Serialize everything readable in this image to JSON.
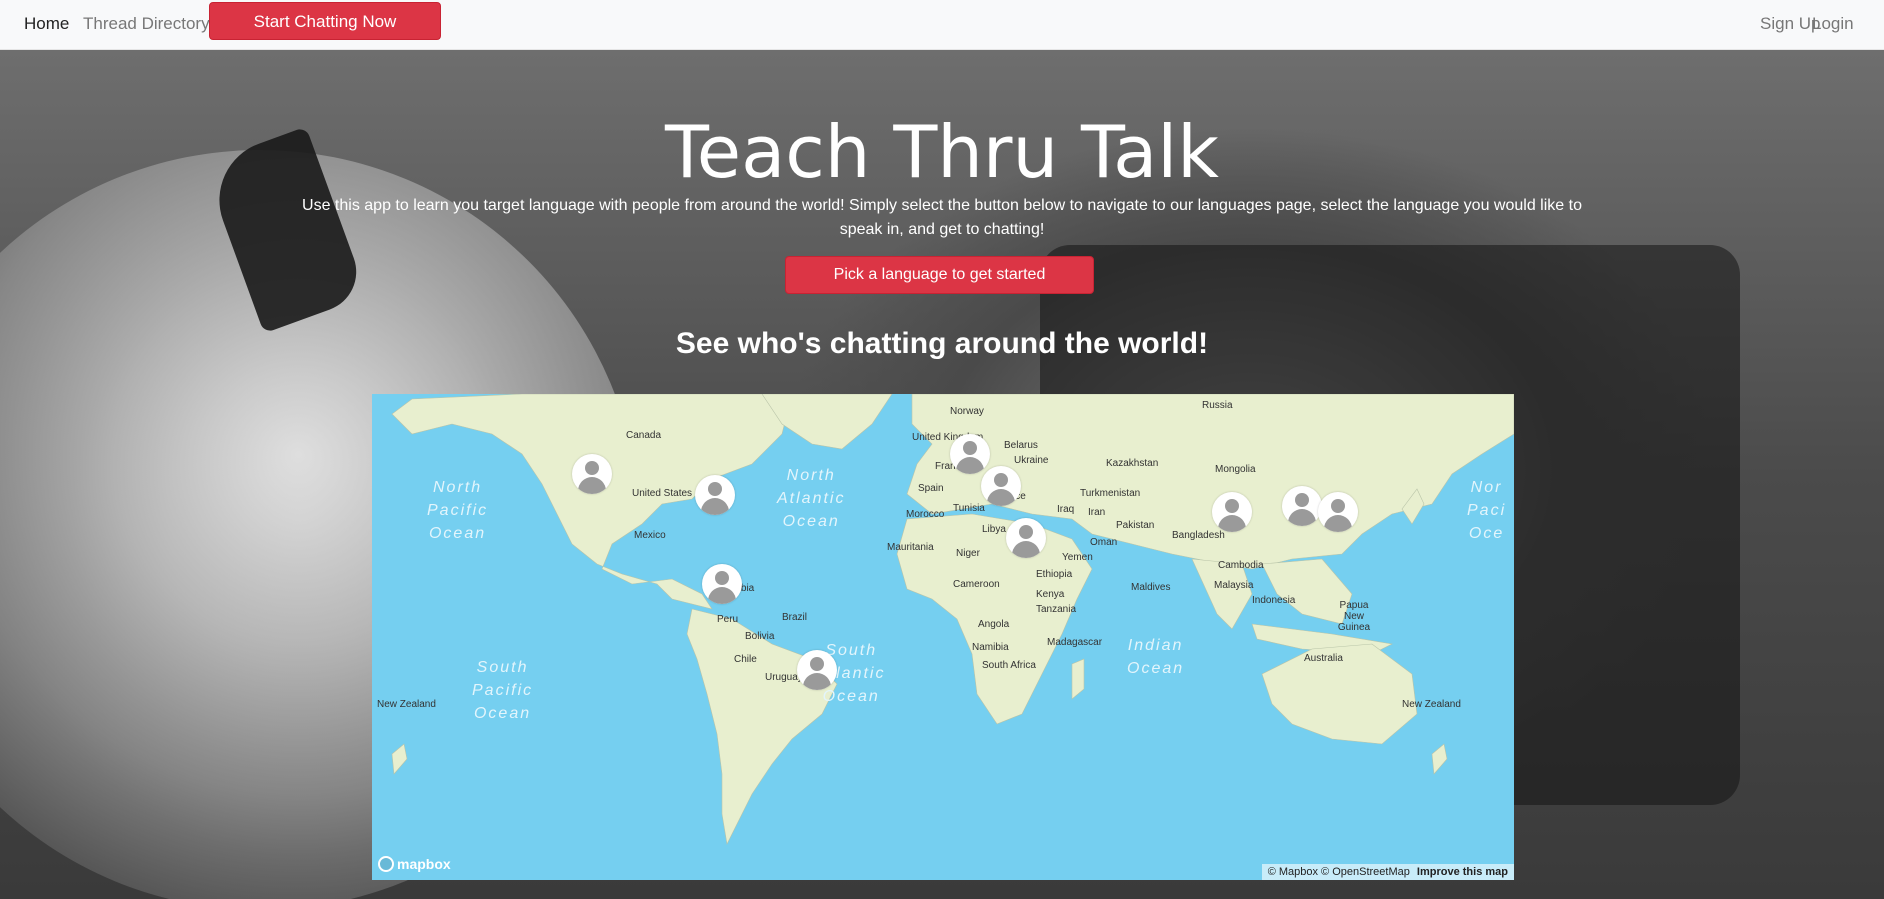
{
  "nav": {
    "home": "Home",
    "thread_directory": "Thread Directory",
    "start_chatting": "Start Chatting Now",
    "sign_up": "Sign Up",
    "login": "Login"
  },
  "hero": {
    "title": "Teach Thru Talk",
    "intro": "Use this app to learn you target language with people from around the world! Simply select the button below to navigate to our languages page, select the language you would like to speak in, and get to chatting!",
    "cta": "Pick a language to get started",
    "subtitle": "See who's chatting around the world!"
  },
  "map": {
    "labels": {
      "russia": "Russia",
      "norway": "Norway",
      "canada": "Canada",
      "united_kingdom": "United Kingdom",
      "belarus": "Belarus",
      "ukraine": "Ukraine",
      "france": "France",
      "kazakhstan": "Kazakhstan",
      "mongolia": "Mongolia",
      "spain": "Spain",
      "united_states": "United States",
      "tunisia": "Tunisia",
      "greece": "Greece",
      "turkmenistan": "Turkmenistan",
      "morocco": "Morocco",
      "iraq": "Iraq",
      "iran": "Iran",
      "pakistan": "Pakistan",
      "mexico": "Mexico",
      "libya": "Libya",
      "bangladesh": "Bangladesh",
      "mauritania": "Mauritania",
      "niger": "Niger",
      "oman": "Oman",
      "yemen": "Yemen",
      "cambodia": "Cambodia",
      "ethiopia": "Ethiopia",
      "colombia": "Colombia",
      "cameroon": "Cameroon",
      "maldives": "Maldives",
      "malaysia": "Malaysia",
      "kenya": "Kenya",
      "indonesia": "Indonesia",
      "papua_new_guinea": "Papua New Guinea",
      "peru": "Peru",
      "brazil": "Brazil",
      "tanzania": "Tanzania",
      "bolivia": "Bolivia",
      "angola": "Angola",
      "madagascar": "Madagascar",
      "chile": "Chile",
      "namibia": "Namibia",
      "australia": "Australia",
      "uruguay": "Uruguay",
      "south_africa": "South Africa",
      "new_zealand_west": "New Zealand",
      "new_zealand_east": "New Zealand"
    },
    "oceans": {
      "north_pacific": "North Pacific Ocean",
      "north_atlantic": "North Atlantic Ocean",
      "south_pacific": "South Pacific Ocean",
      "south_atlantic": "South Atlantic Ocean",
      "indian": "Indian Ocean",
      "north_pacific_east": "Nor Paci Oce"
    },
    "markers_count": 10,
    "attribution": "© Mapbox © OpenStreetMap",
    "improve": "Improve this map",
    "logo": "mapbox"
  },
  "colors": {
    "accent": "#dc3545",
    "ocean": "#75cff0",
    "land": "#e8efcf"
  }
}
